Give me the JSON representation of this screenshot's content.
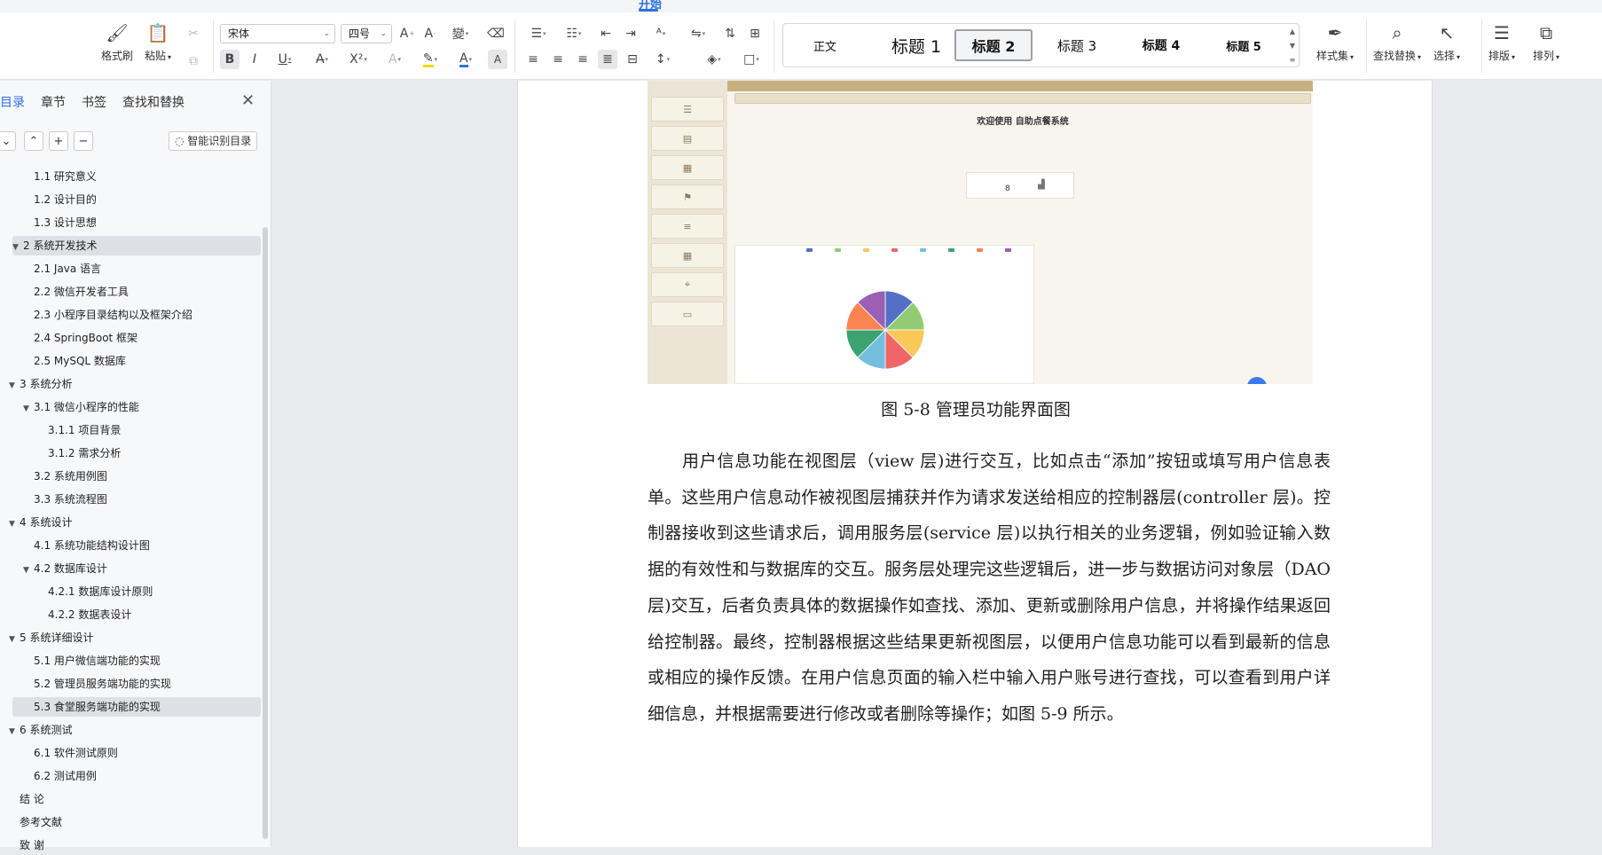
{
  "tabstrip": {
    "active_tab": "开始"
  },
  "ribbon": {
    "format_painter": "格式刷",
    "paste": "粘贴",
    "font_name": "宋体",
    "font_size": "四号",
    "styles": [
      "正文",
      "标题 1",
      "标题 2",
      "标题 3",
      "标题 4",
      "标题 5"
    ],
    "selected_style": "标题 2",
    "style_set": "样式集",
    "find_replace": "查找替换",
    "select": "选择",
    "layout": "排版",
    "arrange": "排列"
  },
  "nav": {
    "tabs": [
      "目录",
      "章节",
      "书签",
      "查找和替换"
    ],
    "active_tab": "目录",
    "ai_toc_button": "智能识别目录",
    "toc": [
      {
        "text": "1.1 研究意义",
        "level": 2
      },
      {
        "text": "1.2 设计目的",
        "level": 2
      },
      {
        "text": "1.3 设计思想",
        "level": 2
      },
      {
        "text": "2 系统开发技术",
        "level": 1,
        "expanded": true,
        "highlight": true
      },
      {
        "text": "2.1 Java 语言",
        "level": 2
      },
      {
        "text": "2.2 微信开发者工具",
        "level": 2
      },
      {
        "text": "2.3 小程序目录结构以及框架介绍",
        "level": 2
      },
      {
        "text": "2.4 SpringBoot 框架",
        "level": 2
      },
      {
        "text": "2.5 MySQL 数据库",
        "level": 2
      },
      {
        "text": "3 系统分析",
        "level": 1,
        "expanded": true
      },
      {
        "text": "3.1 微信小程序的性能",
        "level": 2,
        "expanded": true
      },
      {
        "text": "3.1.1 项目背景",
        "level": 3
      },
      {
        "text": "3.1.2 需求分析",
        "level": 3
      },
      {
        "text": "3.2 系统用例图",
        "level": 2
      },
      {
        "text": "3.3  系统流程图",
        "level": 2
      },
      {
        "text": "4  系统设计",
        "level": 1,
        "expanded": true
      },
      {
        "text": "4.1 系统功能结构设计图",
        "level": 2
      },
      {
        "text": "4.2 数据库设计",
        "level": 2,
        "expanded": true
      },
      {
        "text": "4.2.1 数据库设计原则",
        "level": 3
      },
      {
        "text": "4.2.2    数据表设计",
        "level": 3
      },
      {
        "text": "5 系统详细设计",
        "level": 1,
        "expanded": true
      },
      {
        "text": "5.1 用户微信端功能的实现",
        "level": 2
      },
      {
        "text": "5.2 管理员服务端功能的实现",
        "level": 2
      },
      {
        "text": "5.3 食堂服务端功能的实现",
        "level": 2,
        "highlight": true
      },
      {
        "text": "6   系统测试",
        "level": 1,
        "expanded": true
      },
      {
        "text": "6.1 软件测试原则",
        "level": 2
      },
      {
        "text": "6.2 测试用例",
        "level": 2
      },
      {
        "text": "结  论",
        "level": 1
      },
      {
        "text": "参考文献",
        "level": 1
      },
      {
        "text": "致  谢",
        "level": 1
      }
    ]
  },
  "figure": {
    "welcome": "欢迎使用 自助点餐系统",
    "stat_value": "8",
    "caption": "图 5-8 管理员功能界面图"
  },
  "document": {
    "paragraph": "用户信息功能在视图层（view 层)进行交互，比如点击“添加”按钮或填写用户信息表单。这些用户信息动作被视图层捕获并作为请求发送给相应的控制器层(controller 层)。控制器接收到这些请求后，调用服务层(service 层)以执行相关的业务逻辑，例如验证输入数据的有效性和与数据库的交互。服务层处理完这些逻辑后，进一步与数据访问对象层（DAO 层)交互，后者负责具体的数据操作如查找、添加、更新或删除用户信息，并将操作结果返回给控制器。最终，控制器根据这些结果更新视图层，以便用户信息功能可以看到最新的信息或相应的操作反馈。在用户信息页面的输入栏中输入用户账号进行查找，可以查看到用户详细信息，并根据需要进行修改或者删除等操作；如图 5-9 所示。"
  },
  "colors": {
    "accent": "#2f6fe4",
    "pie": [
      "#5470c6",
      "#91cc75",
      "#fac858",
      "#ee6666",
      "#73c0de",
      "#3ba272",
      "#fc8452",
      "#9a60b4"
    ]
  }
}
